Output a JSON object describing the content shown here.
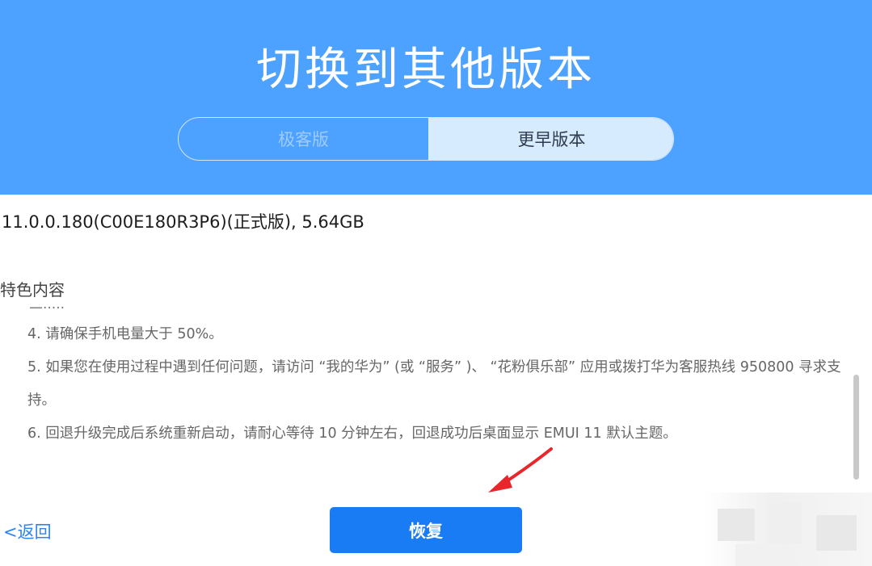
{
  "header": {
    "title": "切换到其他版本",
    "tabs": [
      {
        "label": "极客版",
        "active": false
      },
      {
        "label": "更早版本",
        "active": true
      }
    ]
  },
  "version_info": "11.0.0.180(C00E180R3P6)(正式版), 5.64GB",
  "features": {
    "title": "特色内容",
    "cut_line": "二.....",
    "notes": [
      "4. 请确保手机电量大于 50%。",
      "5. 如果您在使用过程中遇到任何问题，请访问 “我的华为” (或 “服务” )、 “花粉俱乐部” 应用或拨打华为客服热线 950800 寻求支持。",
      "6. 回退升级完成后系统重新启动，请耐心等待 10 分钟左右，回退成功后桌面显示 EMUI 11 默认主题。"
    ]
  },
  "actions": {
    "back_label": "<返回",
    "restore_label": "恢复"
  },
  "colors": {
    "header_bg": "#4da1ff",
    "active_tab_bg": "#d7ebff",
    "primary_button": "#1a7cf4",
    "link": "#2f84ee",
    "annotation_arrow": "#e8262b"
  },
  "icons": {
    "annotation": "red-arrow-icon"
  }
}
